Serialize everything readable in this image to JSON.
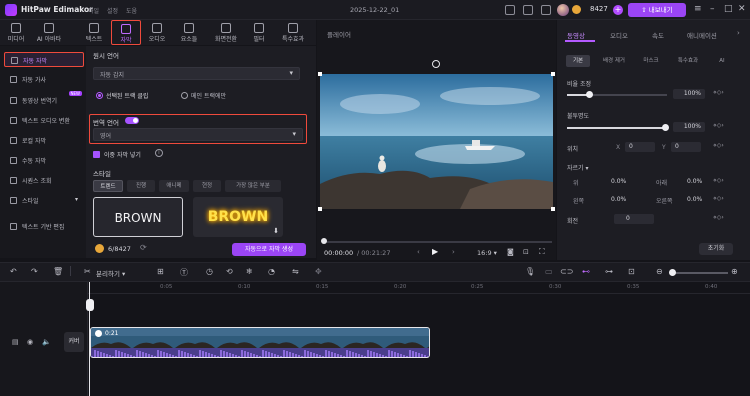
{
  "app": {
    "name": "HitPaw Edimakor",
    "menu": [
      "파일",
      "설정",
      "도움"
    ],
    "document_title": "2025-12-22_01",
    "coins": "8427",
    "export_label": "내보내기"
  },
  "media_tabs": [
    {
      "label": "미디어",
      "icon": "media-icon"
    },
    {
      "label": "AI 아바타",
      "icon": "avatar-icon"
    },
    {
      "label": "텍스트",
      "icon": "text-icon"
    },
    {
      "label": "자막",
      "icon": "subtitle-icon",
      "active": true
    },
    {
      "label": "오디오",
      "icon": "audio-icon"
    },
    {
      "label": "요소들",
      "icon": "elements-icon"
    },
    {
      "label": "화면전환",
      "icon": "transition-icon"
    },
    {
      "label": "필터",
      "icon": "filter-icon"
    },
    {
      "label": "특수효과",
      "icon": "effects-icon"
    }
  ],
  "sidebar": [
    {
      "label": "자동 자막",
      "active": true
    },
    {
      "label": "자동 가사"
    },
    {
      "label": "동영상 번역기",
      "badge": "NEW"
    },
    {
      "label": "텍스트 오디오 변환"
    },
    {
      "label": "로컬 자막"
    },
    {
      "label": "수동 자막"
    },
    {
      "label": "시퀀스 조회"
    },
    {
      "label": "스타일"
    },
    {
      "label": "텍스트 기반 편집"
    }
  ],
  "caption_panel": {
    "spoken_language_label": "원시 언어",
    "spoken_language_value": "자동 감지",
    "radio_selected": "선택된 트랙 클립",
    "radio_other": "메인 트랙에만",
    "translate_label": "번역 언어",
    "translate_value": "영어",
    "bilingual_label": "이중 자막 넣기",
    "style_label": "스타일",
    "style_tabs": [
      "트렌드",
      "진행",
      "애니메",
      "현정",
      "가장 많은 부분"
    ],
    "preset_a": "BROWN",
    "preset_b": "BROWN",
    "credits": "6/8427",
    "generate_label": "자동으로 자막 생성"
  },
  "player": {
    "title": "플레이어",
    "time_current": "00:00:00",
    "time_total": "/ 00:21:27",
    "ratio": "16:9"
  },
  "right_panel": {
    "tabs": [
      "동영상",
      "오디오",
      "속도",
      "애니메이션"
    ],
    "subtabs": [
      "기본",
      "배경 제거",
      "마스크",
      "특수효과",
      "AI"
    ],
    "scale_label": "비율 조정",
    "scale_value": "100%",
    "opacity_label": "불투명도",
    "opacity_value": "100%",
    "position_label": "위치",
    "pos_x_label": "X",
    "pos_x": "0",
    "pos_y_label": "Y",
    "pos_y": "0",
    "crop_label": "자르기",
    "crop_top": "0.0%",
    "crop_bottom": "0.0%",
    "crop_left": "0.0%",
    "crop_right": "0.0%",
    "crop_top_label": "위",
    "crop_bottom_label": "아래",
    "crop_left_label": "왼쪽",
    "crop_right_label": "오른쪽",
    "rotate_label": "회전",
    "rotate_value": "0",
    "reset_label": "초기화"
  },
  "timeline": {
    "split_label": "분리하기",
    "ticks": [
      "0:05",
      "0:10",
      "0:15",
      "0:20",
      "0:25",
      "0:30",
      "0:35",
      "0:40"
    ],
    "clip_duration": "0:21",
    "track_label": "커버"
  }
}
